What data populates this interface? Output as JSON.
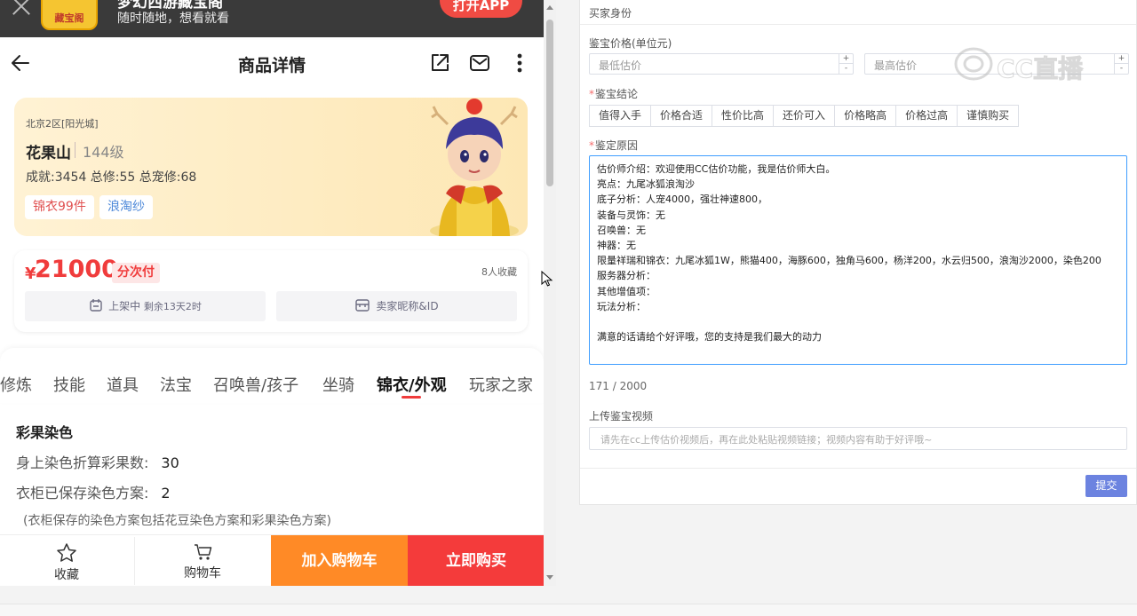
{
  "banner": {
    "logo_text": "藏宝阁",
    "title": "梦幻西游藏宝阁",
    "subtitle": "随时随地，想看就看",
    "open_label": "打开APP"
  },
  "header": {
    "title": "商品详情"
  },
  "role": {
    "server": "北京2区[阳光城]",
    "name": "花果山",
    "level": "144级",
    "stats": "成就:3454 总修:55 总宠修:68",
    "tags": [
      "锦衣99件",
      "浪淘纱"
    ]
  },
  "price": {
    "currency": "¥",
    "amount": "21000",
    "installment": "分次付",
    "favorites": "8人收藏",
    "status": "上架中",
    "remaining": "剩余13天2时",
    "seller": "卖家昵称&ID"
  },
  "tabs": [
    "修炼",
    "技能",
    "道具",
    "法宝",
    "召唤兽/孩子",
    "坐骑",
    "锦衣/外观",
    "玩家之家"
  ],
  "active_tab": "锦衣/外观",
  "dye": {
    "heading": "彩果染色",
    "rows": [
      {
        "label": "身上染色折算彩果数:",
        "value": "30"
      },
      {
        "label": "衣柜已保存染色方案:",
        "value": "2"
      }
    ],
    "note": "(衣柜保存的染色方案包括花豆染色方案和彩果染色方案)"
  },
  "bottom": {
    "fav_label": "收藏",
    "cart_label": "购物车",
    "add_cart": "加入购物车",
    "buy_now": "立即购买"
  },
  "form": {
    "section_title": "买家身份",
    "price_label": "鉴宝价格(单位元)",
    "min_placeholder": "最低估价",
    "max_placeholder": "最高估价",
    "conclusion_label": "鉴宝结论",
    "conclusions": [
      "值得入手",
      "价格合适",
      "性价比高",
      "还价可入",
      "价格略高",
      "价格过高",
      "谨慎购买"
    ],
    "reason_label": "鉴定原因",
    "reason_text": "估价师介绍：欢迎使用CC估价功能，我是估价师大白。\n亮点：九尾冰狐浪淘沙\n底子分析：人宠4000，强壮神速800，\n装备与灵饰：无\n召唤兽：无\n神器：无\n限量祥瑞和锦衣：九尾冰狐1W，熊猫400，海豚600，独角马600，杨洋200，水云归500，浪淘沙2000，染色200\n服务器分析：\n其他增值项：\n玩法分析：\n\n满意的话请给个好评哦，您的支持是我们最大的动力",
    "char_count": "171 / 2000",
    "video_label": "上传鉴宝视频",
    "video_placeholder": "请先在cc上传估价视频后，再在此处粘贴视频链接；视频内容有助于好评哦~",
    "submit_label": "提交"
  },
  "watermark": "CC直播",
  "colors": {
    "accent_red": "#f03c3c",
    "cart_orange": "#ff8a26",
    "buy_red": "#f43b3b",
    "submit_blue": "#6c83e0",
    "focus_blue": "#409eff"
  }
}
